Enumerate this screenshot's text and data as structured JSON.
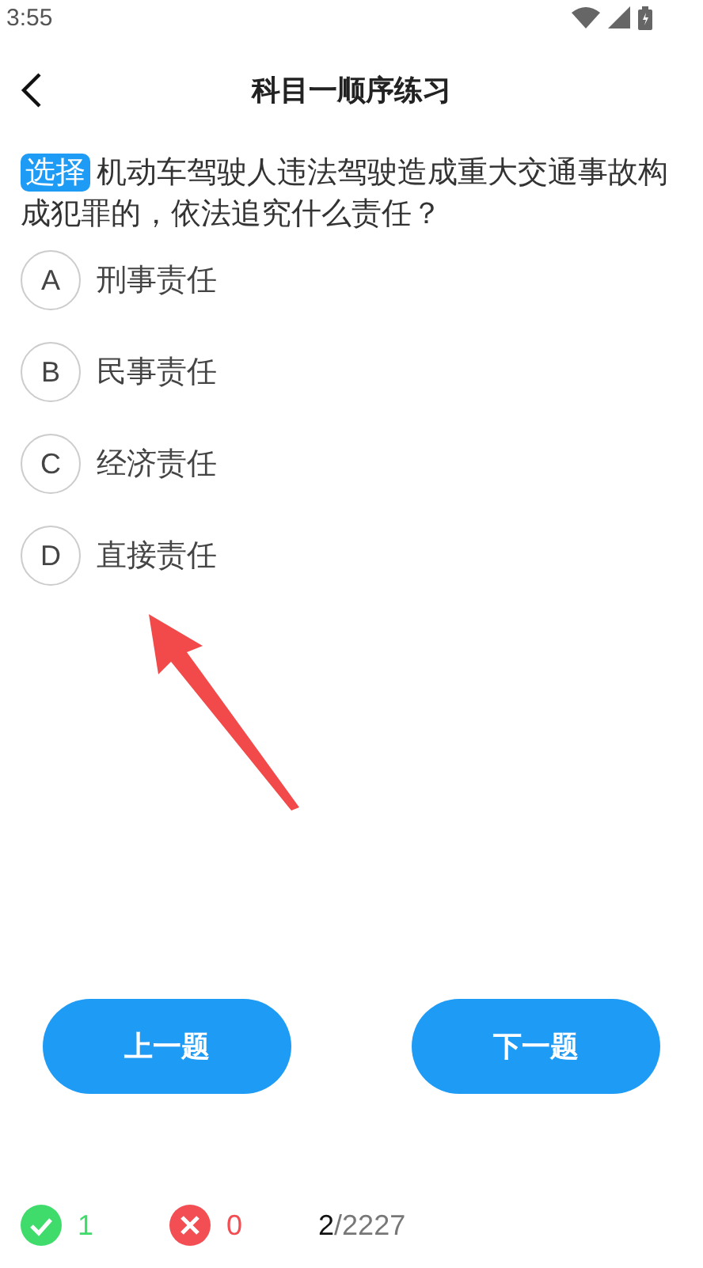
{
  "status_bar": {
    "time": "3:55"
  },
  "header": {
    "title": "科目一顺序练习"
  },
  "question": {
    "type_badge": "选择",
    "text": "机动车驾驶人违法驾驶造成重大交通事故构成犯罪的，依法追究什么责任？"
  },
  "options": [
    {
      "letter": "A",
      "text": "刑事责任",
      "selected": false
    },
    {
      "letter": "B",
      "text": "民事责任",
      "selected": false
    },
    {
      "letter": "C",
      "text": "经济责任",
      "selected": false
    },
    {
      "letter": "D",
      "text": "直接责任",
      "selected": false
    }
  ],
  "buttons": [
    "上一题",
    "下一题"
  ],
  "footer": {
    "correct": "1",
    "wrong": "0",
    "current": "2",
    "total": "/2227"
  }
}
